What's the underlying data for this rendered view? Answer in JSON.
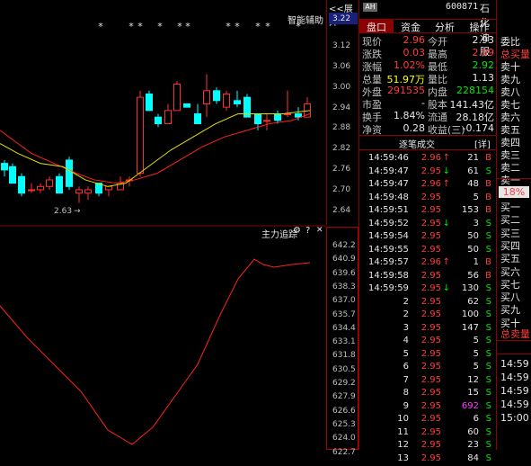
{
  "toolbar": {
    "expand_label": "<<展开",
    "assist_label": "智能辅助",
    "indicator_label": "主力追踪",
    "low_marker": "2.63"
  },
  "price_axis": [
    "3.22",
    "3.12",
    "3.06",
    "3.00",
    "2.94",
    "2.88",
    "2.82",
    "2.76",
    "2.70",
    "2.64"
  ],
  "indicator_axis": [
    "642.2",
    "640.9",
    "639.6",
    "638.3",
    "637.0",
    "635.7",
    "634.4",
    "633.1",
    "631.8",
    "630.5",
    "629.2",
    "627.9",
    "626.6",
    "625.3",
    "624.0",
    "622.7"
  ],
  "header": {
    "badge": "AH",
    "code": "600871",
    "name": "石化油服"
  },
  "tabs": [
    "盘口",
    "资金",
    "分析",
    "操作"
  ],
  "quote": {
    "rows": [
      {
        "l1": "现价",
        "v1": "2.96",
        "c1": "red",
        "l2": "今开",
        "v2": "2.93",
        "c2": "white"
      },
      {
        "l1": "涨跌",
        "v1": "0.03",
        "c1": "red",
        "l2": "最高",
        "v2": "2.99",
        "c2": "red"
      },
      {
        "l1": "涨幅",
        "v1": "1.02%",
        "c1": "red",
        "l2": "最低",
        "v2": "2.92",
        "c2": "green"
      },
      {
        "l1": "总量",
        "v1": "51.97万",
        "c1": "yellow",
        "l2": "量比",
        "v2": "1.13",
        "c2": "white"
      },
      {
        "l1": "外盘",
        "v1": "291535",
        "c1": "red",
        "l2": "内盘",
        "v2": "228154",
        "c2": "green"
      },
      {
        "l1": "市盈",
        "v1": "-",
        "c1": "white",
        "l2": "股本",
        "v2": "141.43亿",
        "c2": "white"
      },
      {
        "l1": "换手",
        "v1": "1.84%",
        "c1": "white",
        "l2": "流通",
        "v2": "28.18亿",
        "c2": "white"
      },
      {
        "l1": "净资",
        "v1": "0.28",
        "c1": "white",
        "l2": "收益(三)",
        "v2": "-0.174",
        "c2": "white"
      }
    ]
  },
  "trades_title": "逐笔成交",
  "trades_btn": "[详]",
  "trades": [
    {
      "t": "14:59:46",
      "p": "2.96",
      "pc": "red",
      "a": "↑",
      "ac": "red",
      "v": "21",
      "vc": "white",
      "d": "B",
      "dc": "red"
    },
    {
      "t": "14:59:47",
      "p": "2.95",
      "pc": "red",
      "a": "↓",
      "ac": "green",
      "v": "61",
      "vc": "white",
      "d": "S",
      "dc": "green"
    },
    {
      "t": "14:59:47",
      "p": "2.96",
      "pc": "red",
      "a": "↑",
      "ac": "red",
      "v": "48",
      "vc": "white",
      "d": "B",
      "dc": "red"
    },
    {
      "t": "14:59:48",
      "p": "2.95",
      "pc": "red",
      "a": "",
      "ac": "red",
      "v": "5",
      "vc": "white",
      "d": "B",
      "dc": "red"
    },
    {
      "t": "14:59:51",
      "p": "2.95",
      "pc": "red",
      "a": "",
      "ac": "red",
      "v": "153",
      "vc": "white",
      "d": "B",
      "dc": "red"
    },
    {
      "t": "14:59:52",
      "p": "2.95",
      "pc": "red",
      "a": "↓",
      "ac": "green",
      "v": "3",
      "vc": "white",
      "d": "S",
      "dc": "green"
    },
    {
      "t": "14:59:54",
      "p": "2.95",
      "pc": "red",
      "a": "",
      "ac": "red",
      "v": "50",
      "vc": "white",
      "d": "S",
      "dc": "green"
    },
    {
      "t": "14:59:55",
      "p": "2.95",
      "pc": "red",
      "a": "",
      "ac": "red",
      "v": "50",
      "vc": "white",
      "d": "S",
      "dc": "green"
    },
    {
      "t": "14:59:57",
      "p": "2.96",
      "pc": "red",
      "a": "↑",
      "ac": "red",
      "v": "1",
      "vc": "white",
      "d": "B",
      "dc": "red"
    },
    {
      "t": "14:59:58",
      "p": "2.95",
      "pc": "red",
      "a": "",
      "ac": "red",
      "v": "56",
      "vc": "white",
      "d": "B",
      "dc": "red"
    },
    {
      "t": "14:59:59",
      "p": "2.95",
      "pc": "red",
      "a": "↓",
      "ac": "green",
      "v": "130",
      "vc": "white",
      "d": "S",
      "dc": "green"
    },
    {
      "t": "2",
      "p": "2.95",
      "pc": "red",
      "a": "",
      "ac": "red",
      "v": "62",
      "vc": "white",
      "d": "S",
      "dc": "green"
    },
    {
      "t": "2",
      "p": "2.95",
      "pc": "red",
      "a": "",
      "ac": "red",
      "v": "100",
      "vc": "white",
      "d": "S",
      "dc": "green"
    },
    {
      "t": "3",
      "p": "2.95",
      "pc": "red",
      "a": "",
      "ac": "red",
      "v": "147",
      "vc": "white",
      "d": "S",
      "dc": "green"
    },
    {
      "t": "4",
      "p": "2.95",
      "pc": "red",
      "a": "",
      "ac": "red",
      "v": "5",
      "vc": "white",
      "d": "S",
      "dc": "green"
    },
    {
      "t": "5",
      "p": "2.95",
      "pc": "red",
      "a": "",
      "ac": "red",
      "v": "5",
      "vc": "white",
      "d": "S",
      "dc": "green"
    },
    {
      "t": "6",
      "p": "2.95",
      "pc": "red",
      "a": "",
      "ac": "red",
      "v": "5",
      "vc": "white",
      "d": "S",
      "dc": "green"
    },
    {
      "t": "7",
      "p": "2.95",
      "pc": "red",
      "a": "",
      "ac": "red",
      "v": "12",
      "vc": "white",
      "d": "S",
      "dc": "green"
    },
    {
      "t": "8",
      "p": "2.95",
      "pc": "red",
      "a": "",
      "ac": "red",
      "v": "15",
      "vc": "white",
      "d": "S",
      "dc": "green"
    },
    {
      "t": "9",
      "p": "2.95",
      "pc": "red",
      "a": "",
      "ac": "red",
      "v": "692",
      "vc": "mag",
      "d": "S",
      "dc": "green"
    },
    {
      "t": "10",
      "p": "2.95",
      "pc": "red",
      "a": "",
      "ac": "red",
      "v": "6",
      "vc": "white",
      "d": "S",
      "dc": "green"
    },
    {
      "t": "11",
      "p": "2.95",
      "pc": "red",
      "a": "",
      "ac": "red",
      "v": "60",
      "vc": "white",
      "d": "S",
      "dc": "green"
    },
    {
      "t": "12",
      "p": "2.95",
      "pc": "red",
      "a": "",
      "ac": "red",
      "v": "23",
      "vc": "white",
      "d": "S",
      "dc": "green"
    },
    {
      "t": "13",
      "p": "2.95",
      "pc": "red",
      "a": "",
      "ac": "red",
      "v": "84",
      "vc": "white",
      "d": "S",
      "dc": "green"
    }
  ],
  "far": {
    "items": [
      {
        "label": "委比",
        "color": "white"
      },
      {
        "label": "总买量",
        "color": "red"
      },
      {
        "label": "卖十",
        "color": "white"
      },
      {
        "label": "卖九",
        "color": "white"
      },
      {
        "label": "卖八",
        "color": "white"
      },
      {
        "label": "卖七",
        "color": "white"
      },
      {
        "label": "卖六",
        "color": "white"
      },
      {
        "label": "卖五",
        "color": "white"
      },
      {
        "label": "卖四",
        "color": "white"
      },
      {
        "label": "卖三",
        "color": "white"
      },
      {
        "label": "卖二",
        "color": "white"
      },
      {
        "label": "卖一",
        "color": "white"
      }
    ],
    "pct": "18%",
    "buy_items": [
      "买一",
      "买二",
      "买三",
      "买四",
      "买五",
      "买六",
      "买七",
      "买八",
      "买九",
      "买十"
    ],
    "total_sell": "总卖量",
    "times": [
      "14:59",
      "14:59",
      "14:59",
      "14:59",
      "15:00"
    ]
  }
}
